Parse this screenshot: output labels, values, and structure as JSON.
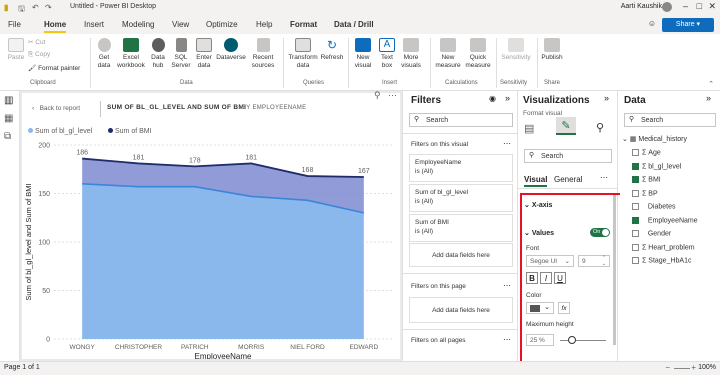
{
  "titlebar": {
    "title": "Untitled - Power BI Desktop",
    "user": "Aarti Kaushik"
  },
  "tabs": [
    "File",
    "Home",
    "Insert",
    "Modeling",
    "View",
    "Optimize",
    "Help",
    "Format",
    "Data / Drill"
  ],
  "share": "Share",
  "ribbon": {
    "clipboard": {
      "paste": "Paste",
      "cut": "Cut",
      "copy": "Copy",
      "format_painter": "Format painter",
      "group": "Clipboard"
    },
    "data": {
      "get_data": "Get data",
      "excel": "Excel workbook",
      "data_hub": "Data hub",
      "sql": "SQL Server",
      "enter_data": "Enter data",
      "dataverse": "Dataverse",
      "recent": "Recent sources",
      "group": "Data"
    },
    "queries": {
      "transform": "Transform data",
      "refresh": "Refresh",
      "group": "Queries"
    },
    "insert": {
      "new_visual": "New visual",
      "text_box": "Text box",
      "more_visuals": "More visuals",
      "group": "Insert"
    },
    "calc": {
      "new_measure": "New measure",
      "quick_measure": "Quick measure",
      "group": "Calculations"
    },
    "sensitivity": {
      "label": "Sensitivity",
      "group": "Sensitivity"
    },
    "share": {
      "publish": "Publish",
      "group": "Share"
    }
  },
  "visual": {
    "back": "Back to report",
    "title": "SUM OF BL_GL_LEVEL AND SUM OF BMI",
    "by": "BY EMPLOYEENAME",
    "legend": [
      "Sum of bl_gl_level",
      "Sum of BMI"
    ]
  },
  "chart_data": {
    "type": "area",
    "categories": [
      "WONGY",
      "CHRISTOPHER",
      "PATRICH",
      "MORRIS",
      "NIEL FORD",
      "EDWARD"
    ],
    "series": [
      {
        "name": "Sum of bl_gl_level",
        "values": [
          160,
          157,
          157,
          147,
          143,
          130
        ],
        "color": "#8ab8ec"
      },
      {
        "name": "Sum of BMI",
        "values": [
          186,
          181,
          178,
          181,
          168,
          167
        ],
        "color": "#1f2c6b"
      }
    ],
    "data_labels": [
      "186",
      "181",
      "178",
      "181",
      "168",
      "167"
    ],
    "yticks": [
      "0",
      "50",
      "100",
      "150",
      "200"
    ],
    "xlabel": "EmployeeName",
    "ylabel": "Sum of bl_gl_level and Sum of BMI",
    "ylim": [
      0,
      200
    ]
  },
  "filters": {
    "title": "Filters",
    "search": "Search",
    "on_visual": "Filters on this visual",
    "cards": [
      {
        "name": "EmployeeName",
        "state": "is (All)"
      },
      {
        "name": "Sum of bl_gl_level",
        "state": "is (All)"
      },
      {
        "name": "Sum of BMI",
        "state": "is (All)"
      }
    ],
    "add": "Add data fields here",
    "on_page": "Filters on this page",
    "add2": "Add data fields here",
    "on_all": "Filters on all pages"
  },
  "viz": {
    "title": "Visualizations",
    "format_visual": "Format visual",
    "search": "Search",
    "tab_visual": "Visual",
    "tab_general": "General",
    "xaxis": "X-axis",
    "values": "Values",
    "toggle": "On",
    "font_label": "Font",
    "font": "Segoe UI",
    "font_size": "9",
    "bold": "B",
    "italic": "I",
    "underline": "U",
    "color_label": "Color",
    "fx": "fx",
    "max_height_label": "Maximum height",
    "max_height": "25 %",
    "max_height_level": 0.25
  },
  "data_pane": {
    "title": "Data",
    "search": "Search",
    "table": "Medical_history",
    "fields": [
      {
        "name": "Age",
        "sigma": true,
        "checked": false
      },
      {
        "name": "bl_gl_level",
        "sigma": true,
        "checked": true
      },
      {
        "name": "BMI",
        "sigma": true,
        "checked": true
      },
      {
        "name": "BP",
        "sigma": true,
        "checked": false
      },
      {
        "name": "Diabetes",
        "sigma": false,
        "checked": false
      },
      {
        "name": "EmployeeName",
        "sigma": false,
        "checked": true
      },
      {
        "name": "Gender",
        "sigma": false,
        "checked": false
      },
      {
        "name": "Heart_problem",
        "sigma": true,
        "checked": false
      },
      {
        "name": "Stage_HbA1c",
        "sigma": true,
        "checked": false
      }
    ]
  },
  "status": {
    "page": "Page 1 of 1",
    "zoom": "100%"
  }
}
